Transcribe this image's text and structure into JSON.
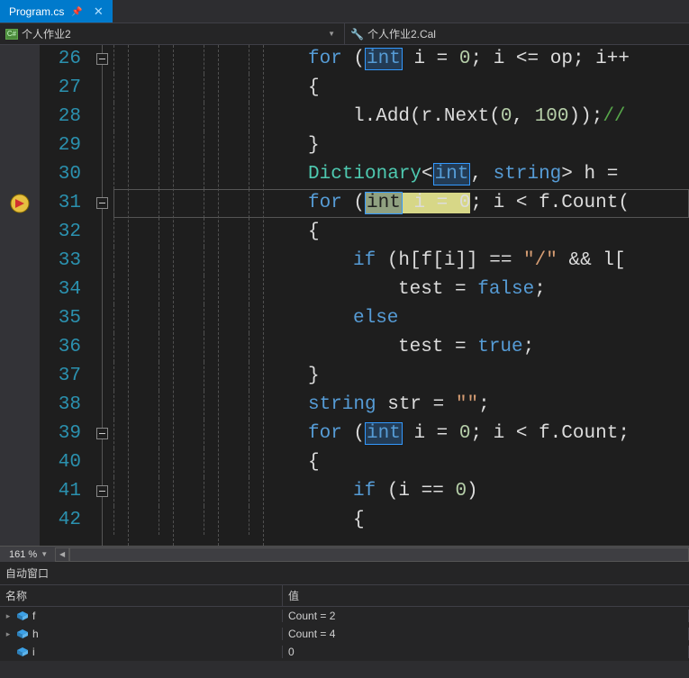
{
  "tab": {
    "filename": "Program.cs"
  },
  "nav": {
    "left_label": "个人作业2",
    "right_label": "个人作业2.Cal"
  },
  "editor": {
    "first_line": 26,
    "current_line": 31,
    "lines": [
      {
        "n": 26,
        "fold": "minus",
        "segments": [
          {
            "t": "for ",
            "c": "kw"
          },
          {
            "t": "(",
            "c": "punct"
          },
          {
            "t": "int",
            "c": "kw",
            "box": true
          },
          {
            "t": " i ",
            "c": "ident"
          },
          {
            "t": "= ",
            "c": "punct"
          },
          {
            "t": "0",
            "c": "num"
          },
          {
            "t": "; i ",
            "c": "ident"
          },
          {
            "t": "<= ",
            "c": "punct"
          },
          {
            "t": "op",
            "c": "ident"
          },
          {
            "t": "; i++",
            "c": "punct"
          }
        ],
        "indent": 4
      },
      {
        "n": 27,
        "segments": [
          {
            "t": "{",
            "c": "punct"
          }
        ],
        "indent": 4
      },
      {
        "n": 28,
        "segments": [
          {
            "t": "l.",
            "c": "ident"
          },
          {
            "t": "Add",
            "c": "ident"
          },
          {
            "t": "(r.",
            "c": "punct"
          },
          {
            "t": "Next",
            "c": "ident"
          },
          {
            "t": "(",
            "c": "punct"
          },
          {
            "t": "0",
            "c": "num"
          },
          {
            "t": ", ",
            "c": "punct"
          },
          {
            "t": "100",
            "c": "num"
          },
          {
            "t": "));",
            "c": "punct"
          },
          {
            "t": "//",
            "c": "comment"
          }
        ],
        "indent": 5
      },
      {
        "n": 29,
        "segments": [
          {
            "t": "}",
            "c": "punct"
          }
        ],
        "indent": 4
      },
      {
        "n": 30,
        "segments": [
          {
            "t": "Dictionary",
            "c": "type"
          },
          {
            "t": "<",
            "c": "punct"
          },
          {
            "t": "int",
            "c": "kw",
            "box": true
          },
          {
            "t": ", ",
            "c": "punct"
          },
          {
            "t": "string",
            "c": "kw"
          },
          {
            "t": "> h = ",
            "c": "punct"
          }
        ],
        "indent": 4
      },
      {
        "n": 31,
        "fold": "minus",
        "current": true,
        "segments": [
          {
            "t": "for ",
            "c": "kw"
          },
          {
            "t": "(",
            "c": "punct"
          },
          {
            "hl": true,
            "parts": [
              {
                "t": "int",
                "c": "kw",
                "box": true
              },
              {
                "t": " i = 0",
                "c": "ident"
              }
            ]
          },
          {
            "t": "; i < f.",
            "c": "ident"
          },
          {
            "t": "Count",
            "c": "ident"
          },
          {
            "t": "(",
            "c": "punct"
          }
        ],
        "indent": 4
      },
      {
        "n": 32,
        "segments": [
          {
            "t": "{",
            "c": "punct"
          }
        ],
        "indent": 4
      },
      {
        "n": 33,
        "segments": [
          {
            "t": "if ",
            "c": "kw"
          },
          {
            "t": "(h[f[i]] == ",
            "c": "punct"
          },
          {
            "t": "\"/\"",
            "c": "str"
          },
          {
            "t": " && l[",
            "c": "punct"
          }
        ],
        "indent": 5
      },
      {
        "n": 34,
        "segments": [
          {
            "t": "test = ",
            "c": "ident"
          },
          {
            "t": "false",
            "c": "kw"
          },
          {
            "t": ";",
            "c": "punct"
          }
        ],
        "indent": 6
      },
      {
        "n": 35,
        "segments": [
          {
            "t": "else",
            "c": "kw"
          }
        ],
        "indent": 5
      },
      {
        "n": 36,
        "segments": [
          {
            "t": "test = ",
            "c": "ident"
          },
          {
            "t": "true",
            "c": "kw"
          },
          {
            "t": ";",
            "c": "punct"
          }
        ],
        "indent": 6
      },
      {
        "n": 37,
        "segments": [
          {
            "t": "}",
            "c": "punct"
          }
        ],
        "indent": 4
      },
      {
        "n": 38,
        "segments": [
          {
            "t": "string",
            "c": "kw"
          },
          {
            "t": " str = ",
            "c": "ident"
          },
          {
            "t": "\"\"",
            "c": "str"
          },
          {
            "t": ";",
            "c": "punct"
          }
        ],
        "indent": 4
      },
      {
        "n": 39,
        "fold": "minus",
        "segments": [
          {
            "t": "for ",
            "c": "kw"
          },
          {
            "t": "(",
            "c": "punct"
          },
          {
            "t": "int",
            "c": "kw",
            "box": true
          },
          {
            "t": " i = ",
            "c": "ident"
          },
          {
            "t": "0",
            "c": "num"
          },
          {
            "t": "; i < f.",
            "c": "ident"
          },
          {
            "t": "Count",
            "c": "ident"
          },
          {
            "t": ";",
            "c": "punct"
          }
        ],
        "indent": 4
      },
      {
        "n": 40,
        "segments": [
          {
            "t": "{",
            "c": "punct"
          }
        ],
        "indent": 4
      },
      {
        "n": 41,
        "fold": "minus",
        "segments": [
          {
            "t": "if ",
            "c": "kw"
          },
          {
            "t": "(i == ",
            "c": "punct"
          },
          {
            "t": "0",
            "c": "num"
          },
          {
            "t": ")",
            "c": "punct"
          }
        ],
        "indent": 5
      },
      {
        "n": 42,
        "segments": [
          {
            "t": "{",
            "c": "punct"
          }
        ],
        "indent": 5
      }
    ]
  },
  "zoom": {
    "level": "161 %"
  },
  "autos": {
    "title": "自动窗口",
    "header_name": "名称",
    "header_value": "值",
    "rows": [
      {
        "name": "f",
        "value": "Count = 2",
        "expandable": true
      },
      {
        "name": "h",
        "value": "Count = 4",
        "expandable": true
      },
      {
        "name": "i",
        "value": "0",
        "expandable": false
      }
    ]
  }
}
